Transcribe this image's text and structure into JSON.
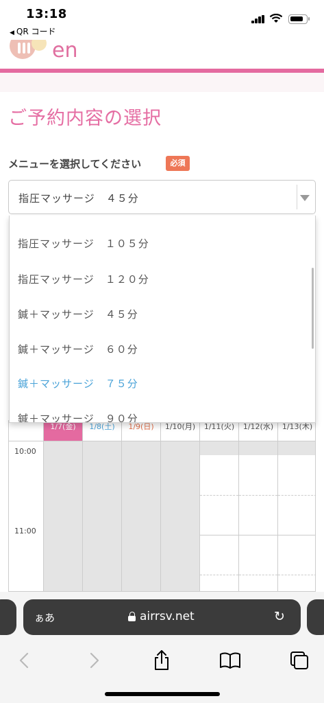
{
  "status_bar": {
    "time": "13:18",
    "back_app": "QR コード"
  },
  "site": {
    "logo_text": "en",
    "brand_color": "#e46aa0"
  },
  "form": {
    "title": "ご予約内容の選択",
    "menu_label": "メニューを選択してください",
    "required_badge": "必須",
    "selected_value": "指圧マッサージ　４５分"
  },
  "dropdown": {
    "options": [
      {
        "label": "指圧マッサージ　１０５分",
        "selected": false
      },
      {
        "label": "指圧マッサージ　１２０分",
        "selected": false
      },
      {
        "label": "鍼＋マッサージ　４５分",
        "selected": false
      },
      {
        "label": "鍼＋マッサージ　６０分",
        "selected": false
      },
      {
        "label": "鍼＋マッサージ　７５分",
        "selected": true
      },
      {
        "label": "鍼＋マッサージ　９０分",
        "selected": false
      }
    ],
    "highlight_color": "#4aa3d8"
  },
  "calendar": {
    "headers": [
      "1/7(金)",
      "1/8(土)",
      "1/9(日)",
      "1/10(月)",
      "1/11(火)",
      "1/12(水)",
      "1/13(木)"
    ],
    "times": [
      "10:00",
      "11:00"
    ]
  },
  "browser": {
    "aa_label": "ぁあ",
    "url": "airrsv.net",
    "back_icon": "chevron-left-icon",
    "forward_icon": "chevron-right-icon",
    "share_icon": "share-icon",
    "bookmarks_icon": "book-icon",
    "tabs_icon": "tabs-icon"
  }
}
